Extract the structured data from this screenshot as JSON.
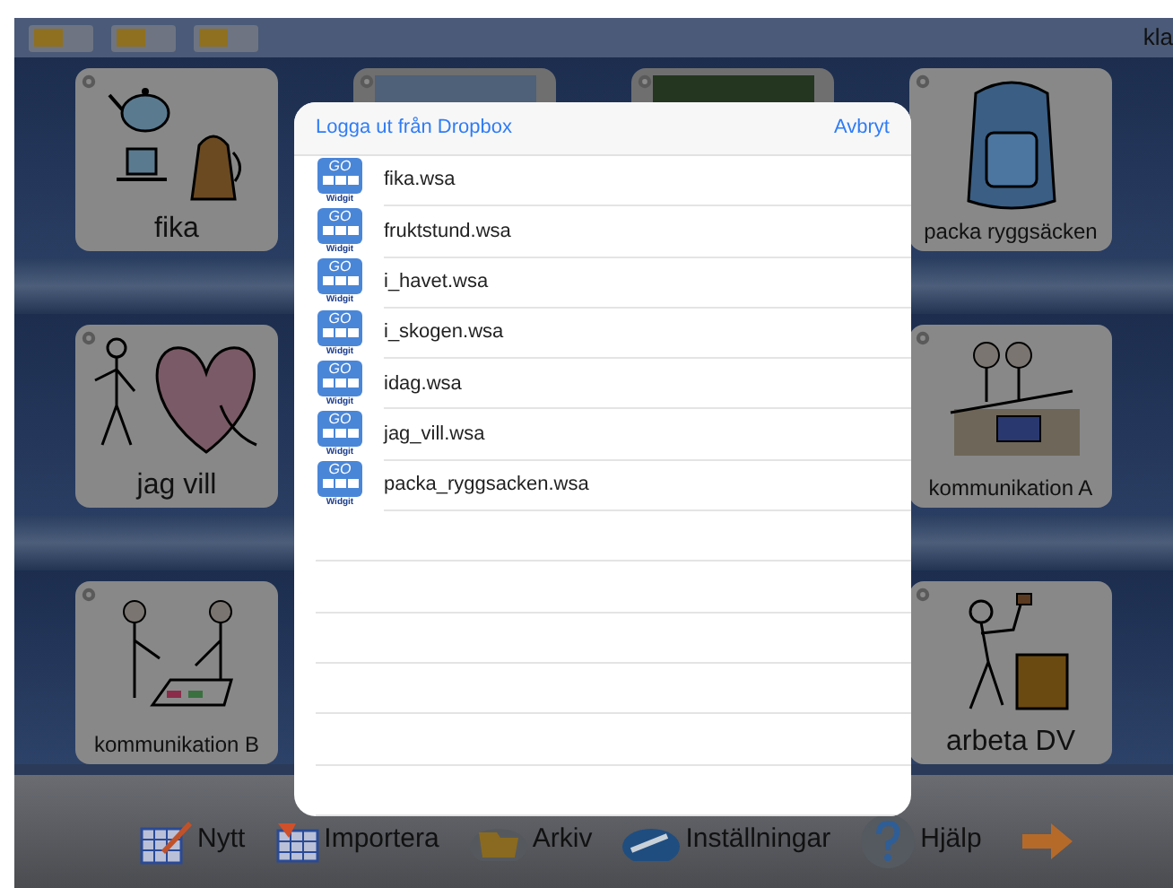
{
  "toolbar": {
    "done_button": "kla"
  },
  "shelves": [
    {
      "tiles": [
        {
          "kind": "symbol",
          "label": "fika"
        },
        {
          "kind": "photo"
        },
        {
          "kind": "photo"
        },
        {
          "kind": "symbol",
          "label": "packa ryggsäcken"
        }
      ]
    },
    {
      "tiles": [
        {
          "kind": "symbol",
          "label": "jag vill"
        },
        {
          "kind": "symbol",
          "label": "kommunikation A"
        }
      ]
    },
    {
      "tiles": [
        {
          "kind": "symbol",
          "label": "kommunikation B"
        },
        {
          "kind": "symbol",
          "label": "arbeta DV"
        }
      ]
    }
  ],
  "dialog": {
    "logout_link": "Logga ut från Dropbox",
    "cancel_link": "Avbryt",
    "files": [
      {
        "name": "fika.wsa",
        "badge": "GO",
        "brand": "Widgit"
      },
      {
        "name": "fruktstund.wsa",
        "badge": "GO",
        "brand": "Widgit"
      },
      {
        "name": "i_havet.wsa",
        "badge": "GO",
        "brand": "Widgit"
      },
      {
        "name": "i_skogen.wsa",
        "badge": "GO",
        "brand": "Widgit"
      },
      {
        "name": "idag.wsa",
        "badge": "GO",
        "brand": "Widgit"
      },
      {
        "name": "jag_vill.wsa",
        "badge": "GO",
        "brand": "Widgit"
      },
      {
        "name": "packa_ryggsacken.wsa",
        "badge": "GO",
        "brand": "Widgit"
      }
    ]
  },
  "bottom_bar": {
    "items": [
      {
        "kind": "new",
        "label": "Nytt"
      },
      {
        "kind": "import",
        "label": "Importera"
      },
      {
        "kind": "archive",
        "label": "Arkiv"
      },
      {
        "kind": "settings",
        "label": "Inställningar"
      },
      {
        "kind": "help",
        "label": "Hjälp"
      },
      {
        "kind": "next"
      }
    ]
  }
}
